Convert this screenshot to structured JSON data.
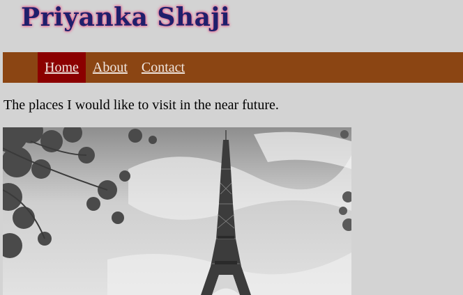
{
  "header": {
    "title": "Priyanka Shaji"
  },
  "nav": {
    "items": [
      {
        "label": "Home",
        "active": true
      },
      {
        "label": "About",
        "active": false
      },
      {
        "label": "Contact",
        "active": false
      }
    ]
  },
  "main": {
    "intro_text": "The places I would like to visit in the near future.",
    "image": {
      "subject": "eiffel-tower-photo",
      "alt": "Eiffel Tower"
    }
  },
  "colors": {
    "page_background": "#d3d3d3",
    "nav_background": "#8b4513",
    "nav_active_background": "#8b0000",
    "title_color": "#1f1f6b",
    "title_glow": "#e85a8a"
  }
}
